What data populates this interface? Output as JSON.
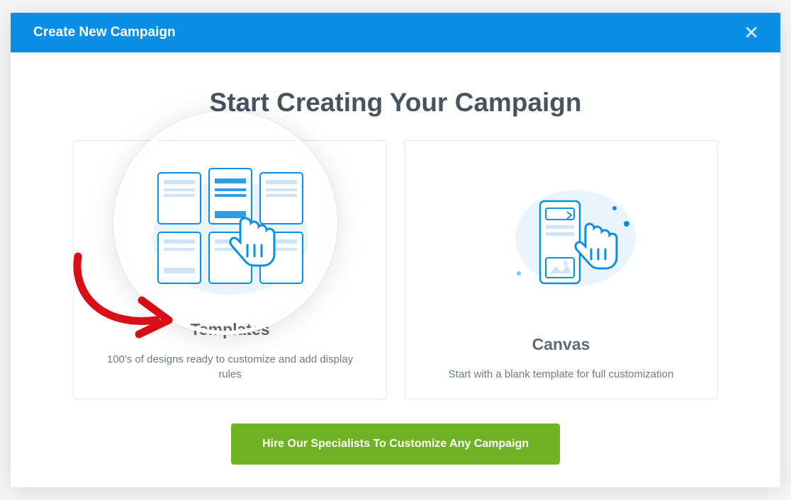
{
  "modal": {
    "title": "Create New Campaign",
    "close_label": "Close"
  },
  "page": {
    "title": "Start Creating Your Campaign"
  },
  "cards": {
    "templates": {
      "title": "Templates",
      "desc": "100's of designs ready to customize and add display rules"
    },
    "canvas": {
      "title": "Canvas",
      "desc": "Start with a blank template for full customization"
    }
  },
  "cta": {
    "label": "Hire Our Specialists To Customize Any Campaign"
  },
  "colors": {
    "brand": "#0a8fe6",
    "cta": "#6fb324",
    "annotation": "#d90d17"
  }
}
